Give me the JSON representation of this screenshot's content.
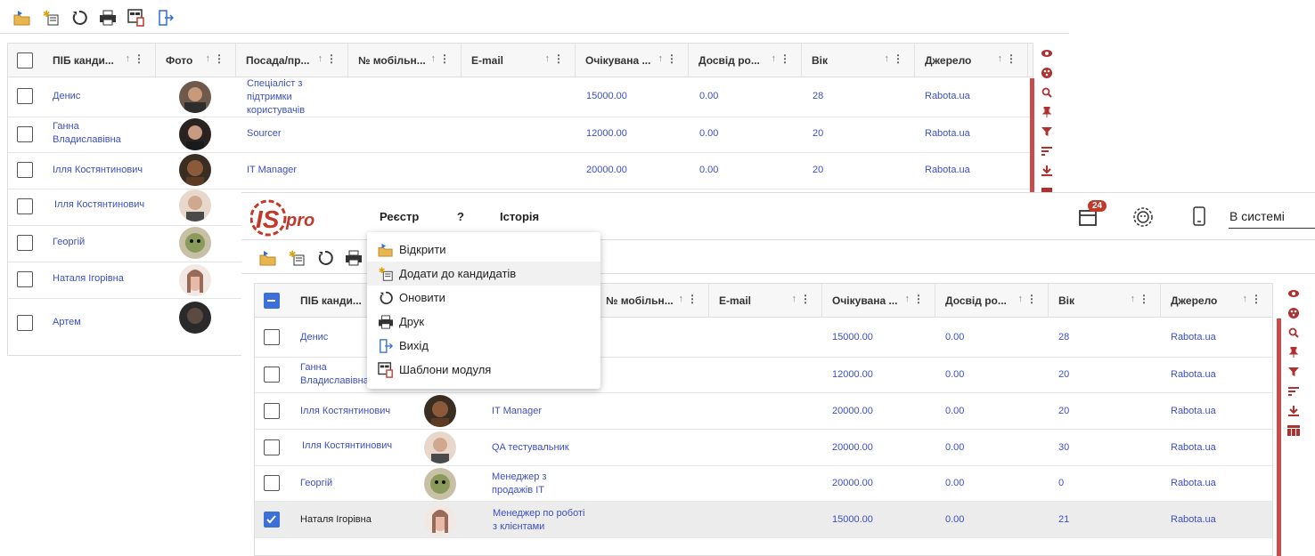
{
  "colors": {
    "link": "#3c4fc4",
    "accent_red": "#c0392b",
    "checkbox_blue": "#3d6fd9",
    "selected_row": "#ececec"
  },
  "background_view": {
    "columns": [
      "ПІБ канди...",
      "Фото",
      "Посада/пр...",
      "№ мобільн...",
      "E-mail",
      "Очікувана ...",
      "Досвід ро...",
      "Вік",
      "Джерело"
    ],
    "rows": [
      {
        "name": "Денис",
        "position": "Спеціаліст з підтримки користувачів",
        "salary": "15000.00",
        "experience": "0.00",
        "age": "28",
        "source": "Rabota.ua"
      },
      {
        "name": "Ганна Владиславівна",
        "position": "Sourcer",
        "salary": "12000.00",
        "experience": "0.00",
        "age": "20",
        "source": "Rabota.ua"
      },
      {
        "name": "Ілля Костянтинович",
        "position": "IT Manager",
        "salary": "20000.00",
        "experience": "0.00",
        "age": "20",
        "source": "Rabota.ua"
      },
      {
        "name": "Ілля Костянтинович"
      },
      {
        "name": "Георгій"
      },
      {
        "name": "Наталя Ігорівна"
      },
      {
        "name": "Артем"
      }
    ]
  },
  "header": {
    "logo_text": "ISpro",
    "menu": [
      "Реєстр",
      "?",
      "Історія"
    ],
    "notifications_count": "24",
    "status_value": "В системі"
  },
  "dropdown": {
    "items": [
      "Відкрити",
      "Додати до кандидатів",
      "Оновити",
      "Друк",
      "Вихід",
      "Шаблони модуля"
    ]
  },
  "front_view": {
    "columns": [
      "ПІБ канди...",
      "№ мобільн...",
      "E-mail",
      "Очікувана ...",
      "Досвід ро...",
      "Вік",
      "Джерело"
    ],
    "rows": [
      {
        "name": "Денис",
        "position": "",
        "salary": "15000.00",
        "experience": "0.00",
        "age": "28",
        "source": "Rabota.ua"
      },
      {
        "name": "Ганна Владиславівна",
        "position": "",
        "salary": "12000.00",
        "experience": "0.00",
        "age": "20",
        "source": "Rabota.ua"
      },
      {
        "name": "Ілля Костянтинович",
        "position": "IT Manager",
        "salary": "20000.00",
        "experience": "0.00",
        "age": "20",
        "source": "Rabota.ua"
      },
      {
        "name": "Ілля Костянтинович",
        "position": "QA тестувальник",
        "salary": "20000.00",
        "experience": "0.00",
        "age": "30",
        "source": "Rabota.ua"
      },
      {
        "name": "Георгій",
        "position": "Менеджер з продажів IT",
        "salary": "20000.00",
        "experience": "0.00",
        "age": "0",
        "source": "Rabota.ua"
      },
      {
        "name": "Наталя Ігорівна",
        "position": "Менеджер по роботі з клієнтами",
        "salary": "15000.00",
        "experience": "0.00",
        "age": "21",
        "source": "Rabota.ua"
      }
    ]
  }
}
